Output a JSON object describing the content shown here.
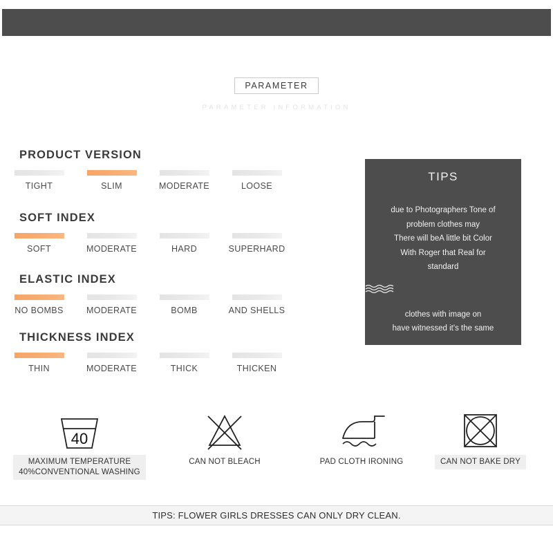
{
  "header": {
    "badge": "PARAMETER",
    "subtitle": "PARAMETER INFORMATION"
  },
  "colors": {
    "dark_bar": "#4d4d4d",
    "accent": "#f6a566",
    "inactive_bar": "#e6e6e6",
    "label_shade": "#efefef"
  },
  "sections": [
    {
      "title": "PRODUCT VERSION",
      "levels": [
        {
          "label": "TIGHT",
          "active": false
        },
        {
          "label": "SLIM",
          "active": true
        },
        {
          "label": "MODERATE",
          "active": false
        },
        {
          "label": "LOOSE",
          "active": false
        }
      ]
    },
    {
      "title": "SOFT INDEX",
      "levels": [
        {
          "label": "SOFT",
          "active": true
        },
        {
          "label": "MODERATE",
          "active": false
        },
        {
          "label": "HARD",
          "active": false
        },
        {
          "label": "SUPERHARD",
          "active": false
        }
      ]
    },
    {
      "title": "ELASTIC INDEX",
      "levels": [
        {
          "label": "NO BOMBS",
          "active": true
        },
        {
          "label": "MODERATE",
          "active": false
        },
        {
          "label": "BOMB",
          "active": false
        },
        {
          "label": "AND SHELLS",
          "active": false
        }
      ]
    },
    {
      "title": "THICKNESS INDEX",
      "levels": [
        {
          "label": "THIN",
          "active": true
        },
        {
          "label": "MODERATE",
          "active": false
        },
        {
          "label": "THICK",
          "active": false
        },
        {
          "label": "THICKEN",
          "active": false
        }
      ]
    }
  ],
  "tips": {
    "title": "TIPS",
    "lines": [
      "due to Photographers Tone of",
      "problem clothes may",
      "There will beA little bit Color",
      "With Roger that Real for",
      "standard"
    ],
    "divider_icon": "waves-icon",
    "footer_lines": [
      "clothes with image on",
      "have witnessed it's the same"
    ]
  },
  "care_instructions": [
    {
      "icon": "wash-tub-icon",
      "temperature": "40",
      "label_lines": [
        "MAXIMUM TEMPERATURE",
        "40%CONVENTIONAL WASHING"
      ],
      "shaded": true
    },
    {
      "icon": "no-bleach-icon",
      "label_lines": [
        "CAN NOT BLEACH"
      ],
      "shaded": false
    },
    {
      "icon": "iron-icon",
      "label_lines": [
        "PAD CLOTH IRONING"
      ],
      "shaded": false
    },
    {
      "icon": "no-tumble-dry-icon",
      "label_lines": [
        "CAN NOT BAKE DRY"
      ],
      "shaded": true
    }
  ],
  "bottom_banner": {
    "text": "TIPS:  FLOWER GIRLS DRESSES CAN ONLY DRY CLEAN."
  }
}
